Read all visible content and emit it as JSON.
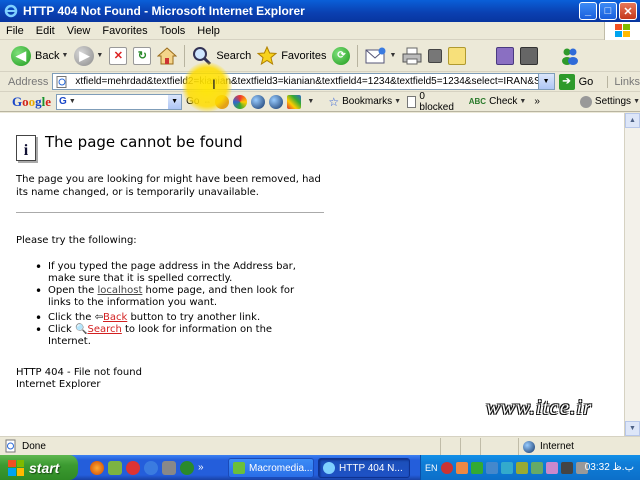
{
  "window": {
    "title": "HTTP 404 Not Found - Microsoft Internet Explorer",
    "minimize": "_",
    "maximize": "□",
    "close": "✕"
  },
  "menu": [
    "File",
    "Edit",
    "View",
    "Favorites",
    "Tools",
    "Help"
  ],
  "toolbar": {
    "back_label": "Back",
    "search_label": "Search",
    "favorites_label": "Favorites"
  },
  "address": {
    "label": "Address",
    "value": "xtfield=mehrdad&textfield2=kianian&textfield3=kianian&textfield4=1234&textfield5=1234&select=IRAN&Submit=Regist",
    "go_label": "Go",
    "links_label": "Links"
  },
  "google_toolbar": {
    "logo_parts": [
      "G",
      "o",
      "o",
      "g",
      "l",
      "e"
    ],
    "search_icon": "G",
    "go_label": "Go",
    "bookmarks_label": "Bookmarks",
    "blocked_label": "0 blocked",
    "check_label": "Check",
    "settings_label": "Settings"
  },
  "page": {
    "title": "The page cannot be found",
    "description": "The page you are looking for might have been removed, had its name changed, or is temporarily unavailable.",
    "try_heading": "Please try the following:",
    "tips": {
      "tip1": "If you typed the page address in the Address bar, make sure that it is spelled correctly.",
      "tip2_before": "Open the ",
      "tip2_link": "localhost",
      "tip2_after": " home page, and then look for links to the information you want.",
      "tip3_before": "Click the ",
      "tip3_link": "Back",
      "tip3_after": " button to try another link.",
      "tip4_before": "Click ",
      "tip4_link": "Search",
      "tip4_after": " to look for information on the Internet."
    },
    "footer_line1": "HTTP 404 - File not found",
    "footer_line2": "Internet Explorer"
  },
  "watermark": "www.itce.ir",
  "status": {
    "text": "Done",
    "zone": "Internet"
  },
  "taskbar": {
    "start_label": "start",
    "tasks": [
      "Macromedia...",
      "HTTP 404 N..."
    ],
    "lang": "EN",
    "clock": "03:32 ب.ظ"
  },
  "colors": {
    "titlebar": "#0a3fb0",
    "taskbar": "#245edb",
    "start": "#3c9b31",
    "link_red": "#d32020"
  }
}
